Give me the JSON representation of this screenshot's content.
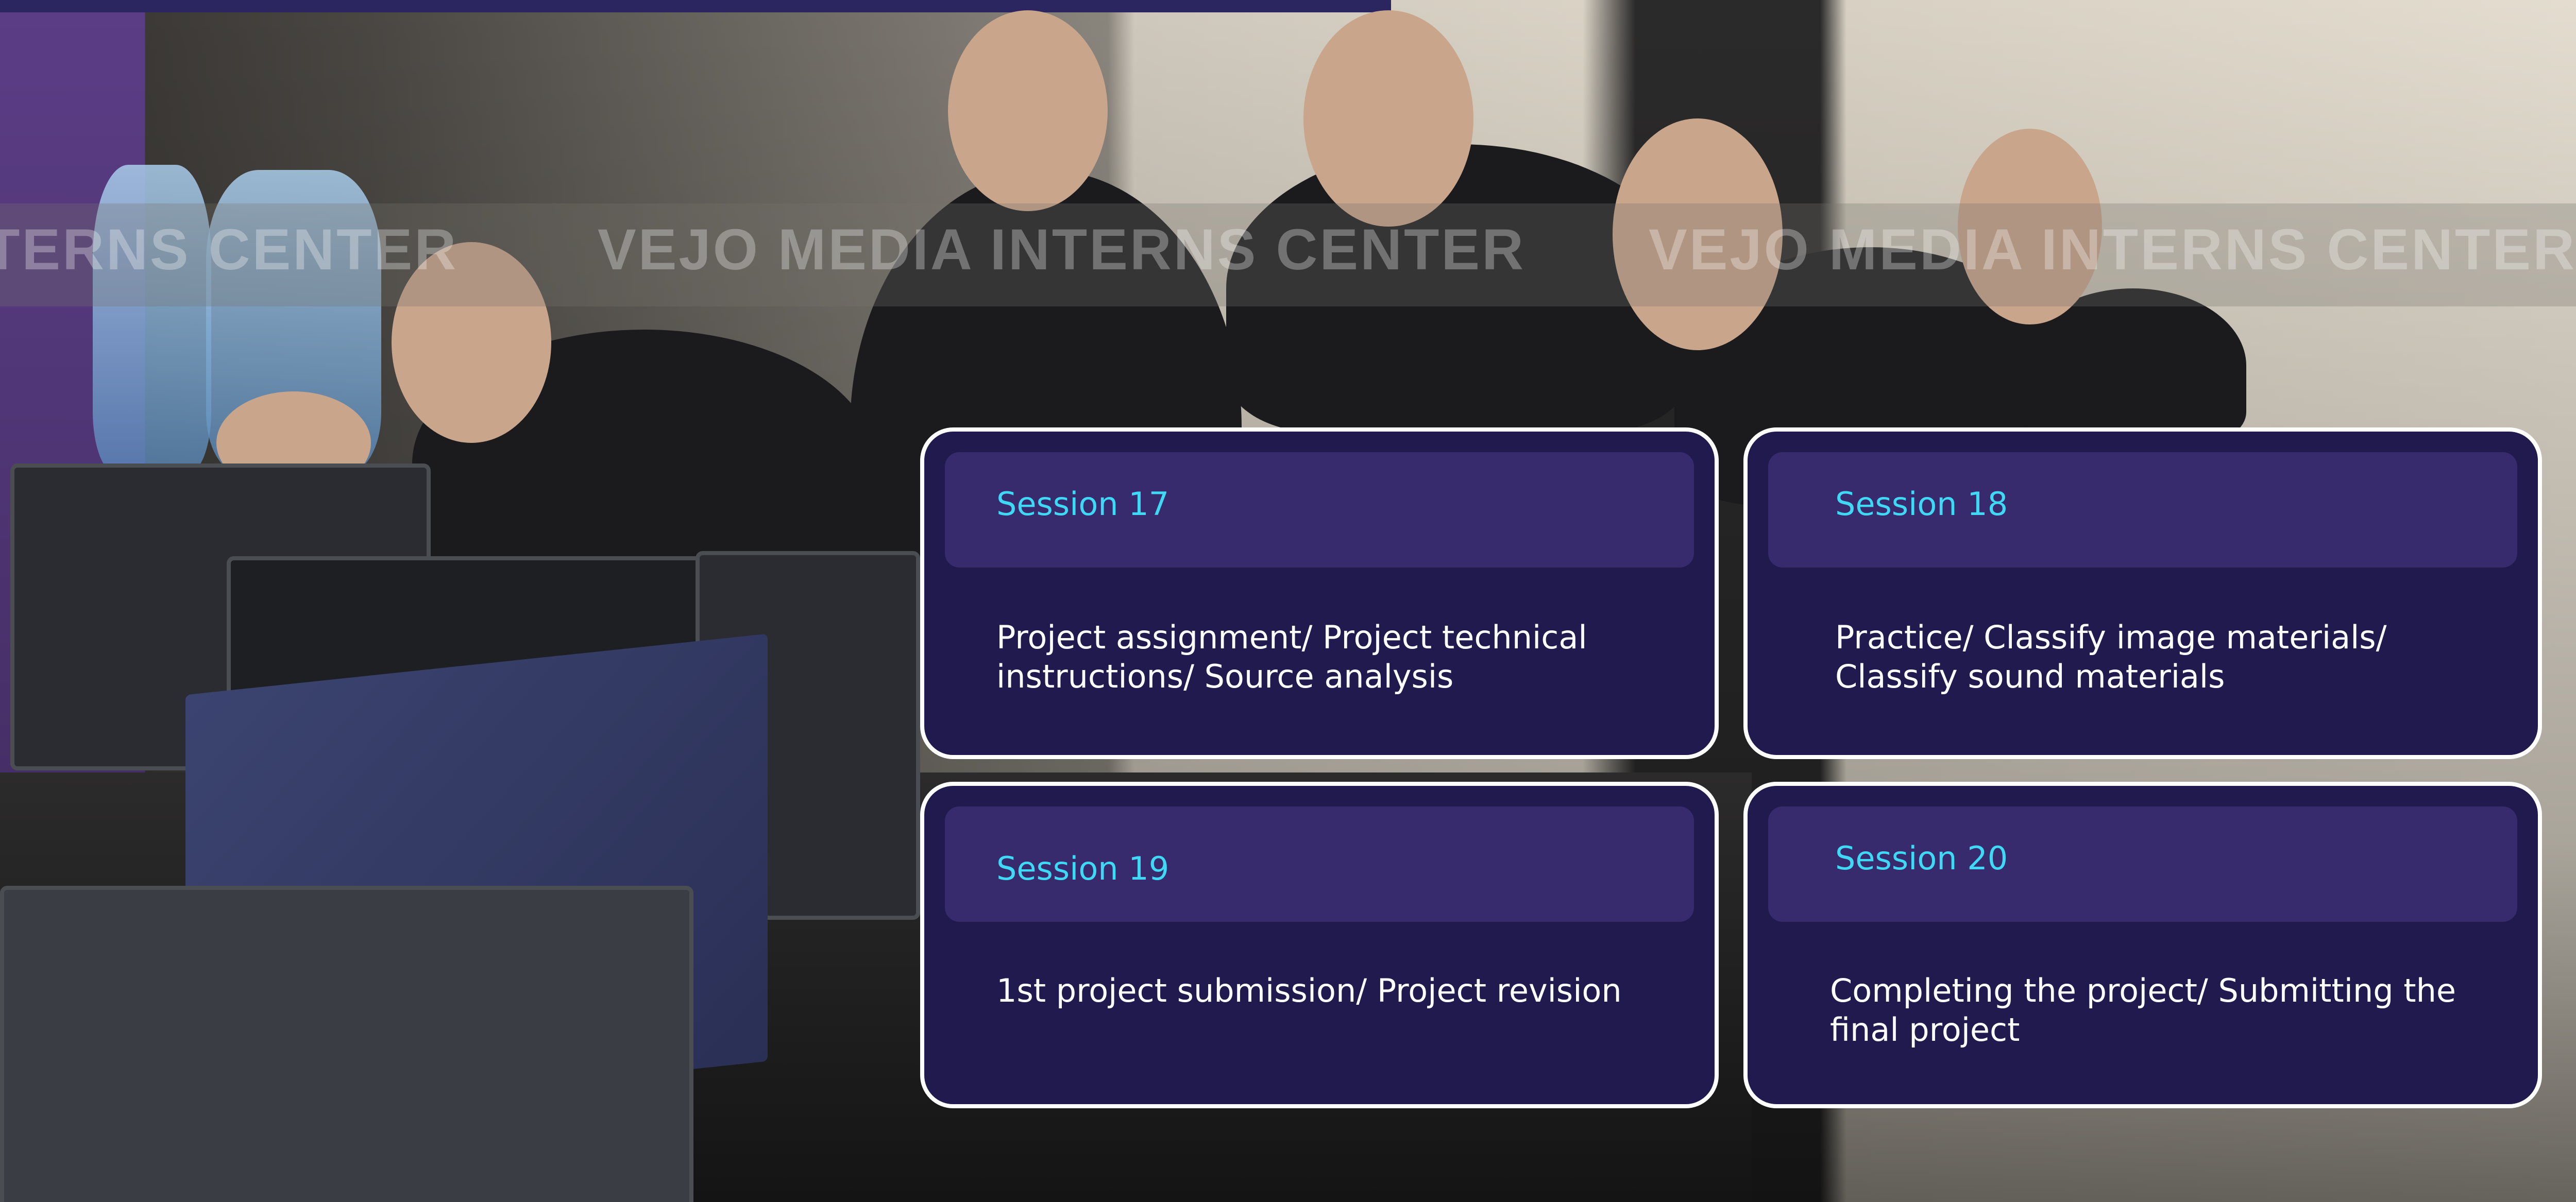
{
  "watermark": {
    "texts": [
      "TERNS CENTER",
      "VEJO MEDIA INTERNS CENTER",
      "VEJO MEDIA INTERNS CENTER"
    ]
  },
  "sessions": [
    {
      "title": "Session 17",
      "description": "Project assignment/ Project technical instructions/ Source analysis"
    },
    {
      "title": "Session 18",
      "description": "Practice/ Classify image materials/ Classify sound materials"
    },
    {
      "title": "Session 19",
      "description": "1st project submission/ Project revision"
    },
    {
      "title": "Session 20",
      "description": "Completing the project/ Submitting the final project"
    }
  ],
  "colors": {
    "card_background": "#211a4e",
    "card_header": "#372b6d",
    "card_border": "#ffffff",
    "title_accent": "#3fd8f5",
    "top_bar": "#2b2560"
  }
}
